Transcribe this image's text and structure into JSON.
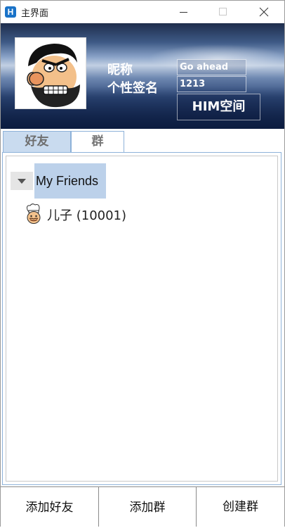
{
  "window": {
    "title": "主界面",
    "icon_letter": "H"
  },
  "profile": {
    "nickname_label": "昵称",
    "signature_label": "个性签名",
    "nickname_value": "Go ahead",
    "signature_value": "1213",
    "space_button": "HIM空间"
  },
  "tabs": [
    {
      "label": "好友",
      "selected": true
    },
    {
      "label": "群",
      "selected": false
    }
  ],
  "friends": {
    "groups": [
      {
        "name": "My Friends",
        "expanded": true,
        "members": [
          {
            "name": "儿子 (10001)"
          }
        ]
      }
    ]
  },
  "bottom": {
    "add_friend": "添加好友",
    "add_group": "添加群",
    "create_group": "创建群"
  },
  "colors": {
    "accent": "#8eb2d9",
    "tab_selected": "#c9dbef",
    "group_highlight": "#bcd1ea"
  }
}
